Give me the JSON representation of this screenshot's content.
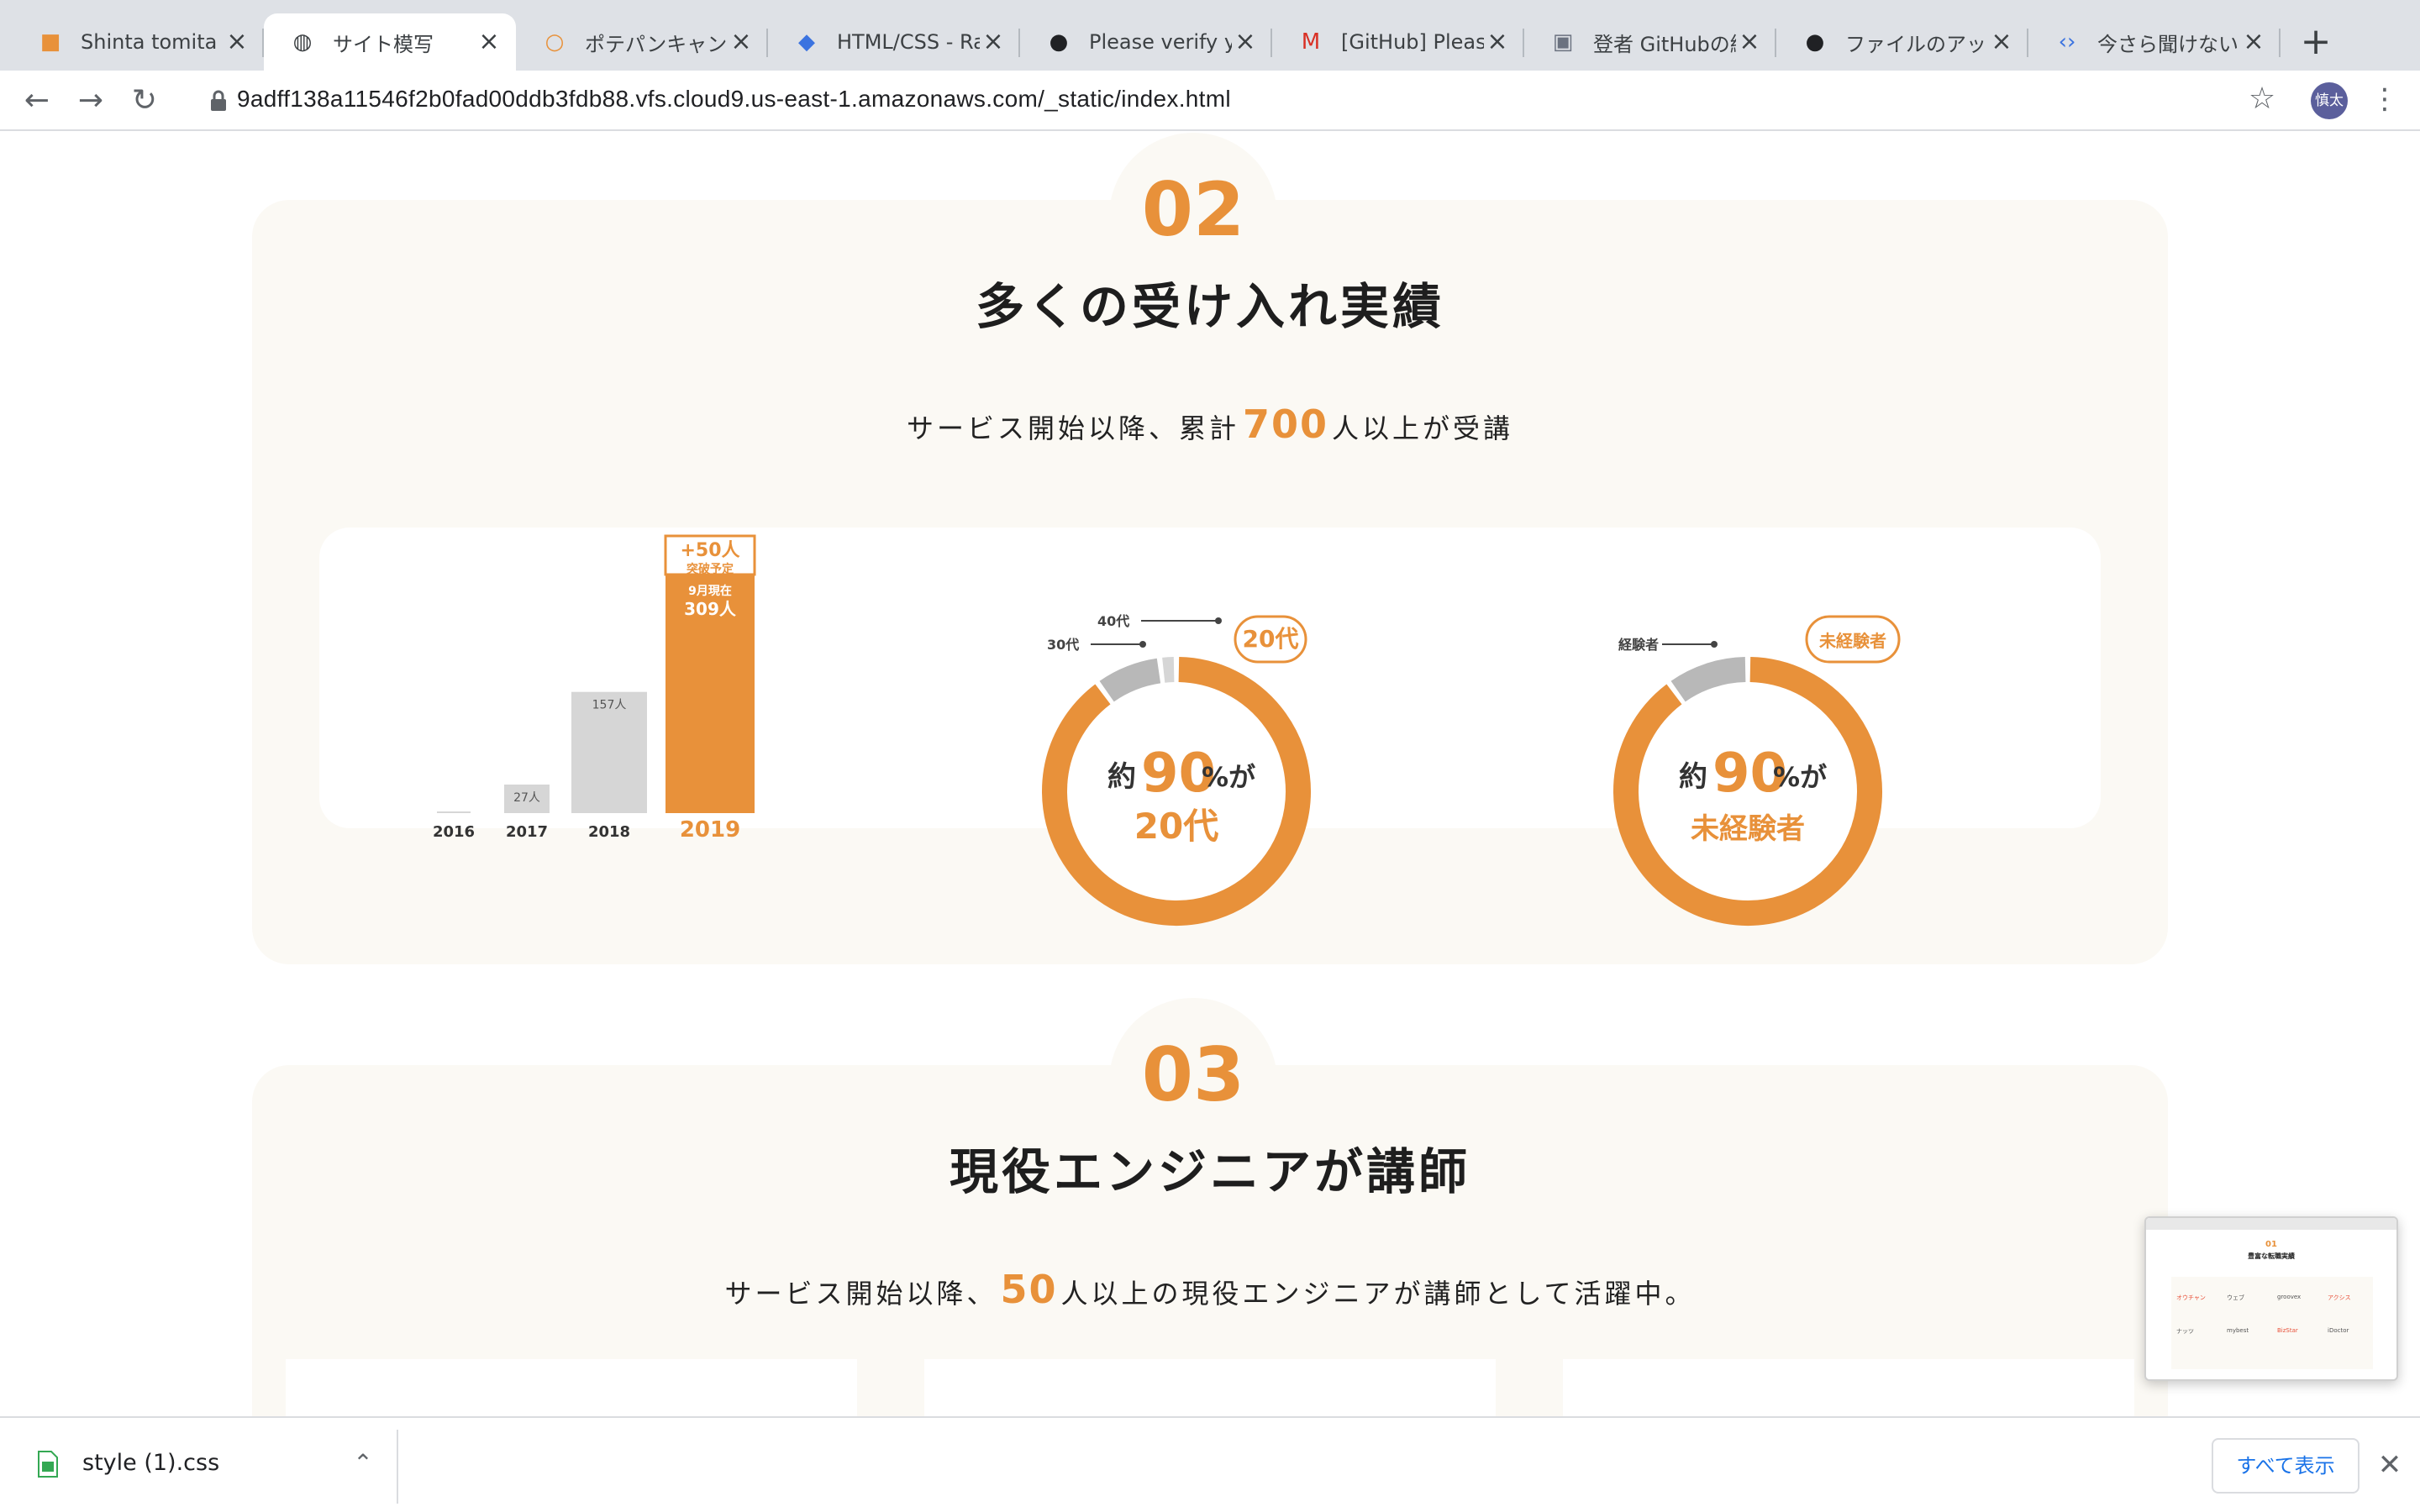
{
  "browser": {
    "tabs": [
      {
        "title": "Shinta tomita -",
        "icon": "cube-icon",
        "color": "#e8913a"
      },
      {
        "title": "サイト模写",
        "icon": "globe-icon",
        "color": "#3c4043",
        "active": true
      },
      {
        "title": "ポテパンキャンプ",
        "icon": "ring-icon",
        "color": "#e8913a"
      },
      {
        "title": "HTML/CSS - Ra",
        "icon": "layers-icon",
        "color": "#3b73e0"
      },
      {
        "title": "Please verify y",
        "icon": "github-icon",
        "color": "#202124"
      },
      {
        "title": "[GitHub] Please",
        "icon": "gmail-icon",
        "color": "#d93025"
      },
      {
        "title": "登者 GitHubの紹",
        "icon": "hatena-icon",
        "color": "#6b7280"
      },
      {
        "title": "ファイルのアップ",
        "icon": "github-icon",
        "color": "#202124"
      },
      {
        "title": "今さら聞けない",
        "icon": "code-icon",
        "color": "#3b73e0"
      }
    ],
    "new_tab_label": "+",
    "url": "9adff138a11546f2b0fad00ddb3fdb88.vfs.cloud9.us-east-1.amazonaws.com/_static/index.html",
    "avatar_label": "慎太"
  },
  "section2": {
    "number": "02",
    "heading": "多くの受け入れ実績",
    "lead_prefix": "サービス開始以降、累計",
    "lead_number": "700",
    "lead_suffix": "人以上が受講"
  },
  "section3": {
    "number": "03",
    "heading": "現役エンジニアが講師",
    "lead_prefix": "サービス開始以降、",
    "lead_number": "50",
    "lead_suffix": "人以上の現役エンジニアが講師として活躍中。"
  },
  "chart_data": [
    {
      "type": "bar",
      "categories": [
        "2016",
        "2017",
        "2018",
        "2019"
      ],
      "values": [
        0,
        27,
        157,
        309
      ],
      "planned_extra": 50,
      "value_labels": [
        "",
        "27人",
        "157人",
        "309人"
      ],
      "highlight_label": "9月現在",
      "planned_label": "+50人",
      "planned_sub_label": "突破予定",
      "colors": {
        "normal": "#d6d6d6",
        "highlight": "#e8913a"
      }
    },
    {
      "type": "pie",
      "labels": [
        "20代",
        "30代",
        "40代"
      ],
      "values": [
        90,
        8,
        2
      ],
      "center_prefix": "約",
      "center_value": "90",
      "center_unit": "%が",
      "center_category": "20代",
      "callout": "20代",
      "colors": [
        "#e8913a",
        "#b8b8b8",
        "#d6d6d6"
      ]
    },
    {
      "type": "pie",
      "labels": [
        "未経験者",
        "経験者"
      ],
      "values": [
        90,
        10
      ],
      "center_prefix": "約",
      "center_value": "90",
      "center_unit": "%が",
      "center_category": "未経験者",
      "callout": "未経験者",
      "colors": [
        "#e8913a",
        "#b8b8b8"
      ]
    }
  ],
  "downloads": {
    "file_name": "style (1).css",
    "show_all_label": "すべて表示"
  },
  "thumbnail": {
    "number": "01",
    "title": "豊富な転職実績",
    "logos": [
      "オウチャン",
      "ウェブ",
      "groovex",
      "アクシス",
      "ナッツ",
      "mybest",
      "BizStar",
      "iDoctor"
    ]
  },
  "colors": {
    "accent": "#e8913a",
    "card_bg": "#fbf9f4",
    "grey": "#b8b8b8"
  }
}
